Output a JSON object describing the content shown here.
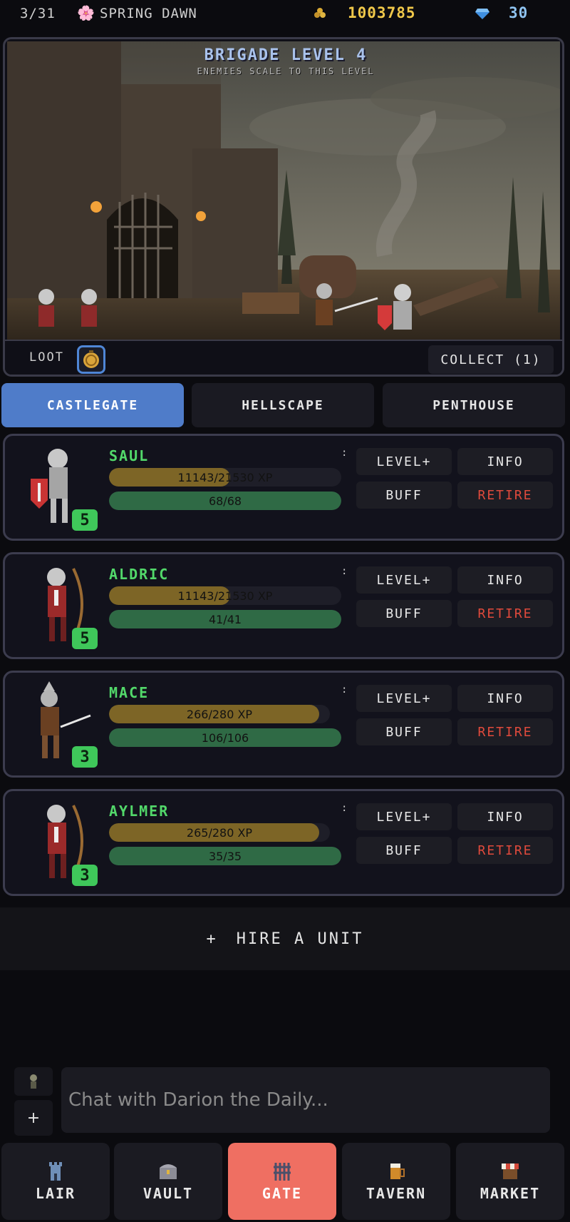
{
  "topbar": {
    "day": "3/31",
    "season": "SPRING DAWN",
    "gold": "1003785",
    "gems": "30",
    "icons": {
      "season": "flower-icon",
      "gold": "coins-icon",
      "gems": "gem-icon"
    }
  },
  "scene": {
    "title": "BRIGADE LEVEL 4",
    "subtitle": "ENEMIES SCALE TO THIS LEVEL",
    "loot_label": "LOOT",
    "collect_label": "COLLECT (1)"
  },
  "tabs": [
    {
      "label": "CASTLEGATE",
      "active": true
    },
    {
      "label": "HELLSCAPE",
      "active": false
    },
    {
      "label": "PENTHOUSE",
      "active": false
    }
  ],
  "units": [
    {
      "name": "SAUL",
      "level": "5",
      "xp_text": "11143/21530 XP",
      "xp_fraction": 0.52,
      "hp_text": "68/68",
      "hp_fraction": 1.0,
      "portrait": "knight-shield"
    },
    {
      "name": "ALDRIC",
      "level": "5",
      "xp_text": "11143/21530 XP",
      "xp_fraction": 0.52,
      "hp_text": "41/41",
      "hp_fraction": 1.0,
      "portrait": "archer"
    },
    {
      "name": "MACE",
      "level": "3",
      "xp_text": "266/280 XP",
      "xp_fraction": 0.95,
      "hp_text": "106/106",
      "hp_fraction": 1.0,
      "portrait": "swordsman"
    },
    {
      "name": "AYLMER",
      "level": "3",
      "xp_text": "265/280 XP",
      "xp_fraction": 0.95,
      "hp_text": "35/35",
      "hp_fraction": 1.0,
      "portrait": "archer"
    }
  ],
  "unit_actions": {
    "level_up": "LEVEL+",
    "info": "INFO",
    "buff": "BUFF",
    "retire": "RETIRE",
    "menu": ":"
  },
  "hire": {
    "plus": "+",
    "label": "HIRE A UNIT"
  },
  "chat": {
    "placeholder": "Chat with Darion the Daily...",
    "plus": "+"
  },
  "nav": [
    {
      "label": "LAIR",
      "icon": "tower-icon",
      "active": false
    },
    {
      "label": "VAULT",
      "icon": "chest-icon",
      "active": false
    },
    {
      "label": "GATE",
      "icon": "portcullis-icon",
      "active": true
    },
    {
      "label": "TAVERN",
      "icon": "beer-mug-icon",
      "active": false
    },
    {
      "label": "MARKET",
      "icon": "market-stall-icon",
      "active": false
    }
  ],
  "colors": {
    "accent_tab": "#4f7cc9",
    "active_nav": "#ef6f62",
    "name_green": "#52d86a",
    "gold": "#f0c84a",
    "gems": "#8fc3f0",
    "retire_red": "#e04a3c"
  }
}
